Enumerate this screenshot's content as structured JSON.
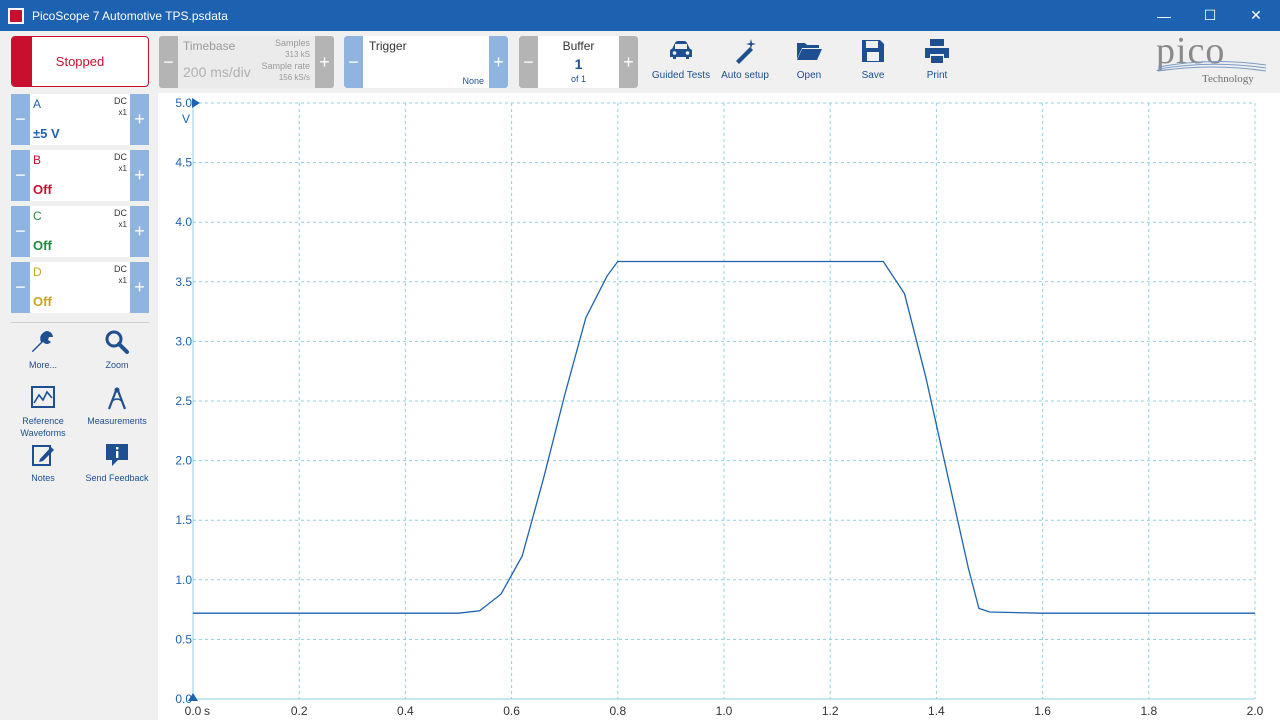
{
  "window": {
    "title": "PicoScope 7 Automotive TPS.psdata",
    "minimize_glyph": "—",
    "maximize_glyph": "☐",
    "close_glyph": "✕"
  },
  "toolbar": {
    "run_state": "Stopped",
    "timebase": {
      "label": "Timebase",
      "value": "200 ms/div",
      "samples_label": "Samples",
      "samples_value": "313 kS",
      "rate_label": "Sample rate",
      "rate_value": "156 kS/s"
    },
    "trigger": {
      "label": "Trigger",
      "mode": "None"
    },
    "buffer": {
      "label": "Buffer",
      "value": "1",
      "of": "of 1"
    },
    "buttons": [
      {
        "label": "Guided Tests",
        "icon": "car-icon"
      },
      {
        "label": "Auto setup",
        "icon": "wand-icon"
      },
      {
        "label": "Open",
        "icon": "folder-icon"
      },
      {
        "label": "Save",
        "icon": "save-icon"
      },
      {
        "label": "Print",
        "icon": "printer-icon"
      }
    ],
    "logo": {
      "word": "pico",
      "sub": "Technology"
    }
  },
  "channels": [
    {
      "letter": "A",
      "coupling": "DC",
      "probe": "x1",
      "range": "±5 V",
      "color": "#1d62b0"
    },
    {
      "letter": "B",
      "coupling": "DC",
      "probe": "x1",
      "range": "Off",
      "color": "#c8102e"
    },
    {
      "letter": "C",
      "coupling": "DC",
      "probe": "x1",
      "range": "Off",
      "color": "#1e8a3c"
    },
    {
      "letter": "D",
      "coupling": "DC",
      "probe": "x1",
      "range": "Off",
      "color": "#c9a227"
    }
  ],
  "side_tools": [
    {
      "label": "More...",
      "icon": "wrench-icon"
    },
    {
      "label": "Zoom",
      "icon": "magnifier-icon"
    },
    {
      "label": "Reference Waveforms",
      "icon": "reference-waveforms-icon"
    },
    {
      "label": "Measurements",
      "icon": "measurements-icon"
    },
    {
      "label": "Notes",
      "icon": "notes-icon"
    },
    {
      "label": "Send Feedback",
      "icon": "feedback-icon"
    }
  ],
  "colors": {
    "accent": "#1d62b0",
    "trace": "#1d62b0",
    "grid": "#8fd0e0",
    "stop": "#c8102e"
  },
  "chart_data": {
    "type": "line",
    "title": "",
    "xlabel": "s",
    "ylabel": "V",
    "xlim": [
      0,
      2.0
    ],
    "ylim": [
      0,
      5.0
    ],
    "x_ticks": [
      "0.0",
      "0.2",
      "0.4",
      "0.6",
      "0.8",
      "1.0",
      "1.2",
      "1.4",
      "1.6",
      "1.8",
      "2.0"
    ],
    "y_ticks": [
      "0.0",
      "0.5",
      "1.0",
      "1.5",
      "2.0",
      "2.5",
      "3.0",
      "3.5",
      "4.0",
      "4.5",
      "5.0"
    ],
    "grid": true,
    "series": [
      {
        "channel": "A",
        "x": [
          0.0,
          0.5,
          0.54,
          0.58,
          0.62,
          0.66,
          0.7,
          0.74,
          0.78,
          0.8,
          1.0,
          1.2,
          1.3,
          1.34,
          1.38,
          1.42,
          1.46,
          1.48,
          1.5,
          1.6,
          1.8,
          2.0
        ],
        "y": [
          0.72,
          0.72,
          0.74,
          0.88,
          1.2,
          1.85,
          2.55,
          3.2,
          3.55,
          3.67,
          3.67,
          3.67,
          3.67,
          3.4,
          2.7,
          1.9,
          1.1,
          0.76,
          0.73,
          0.72,
          0.72,
          0.72
        ]
      }
    ]
  }
}
